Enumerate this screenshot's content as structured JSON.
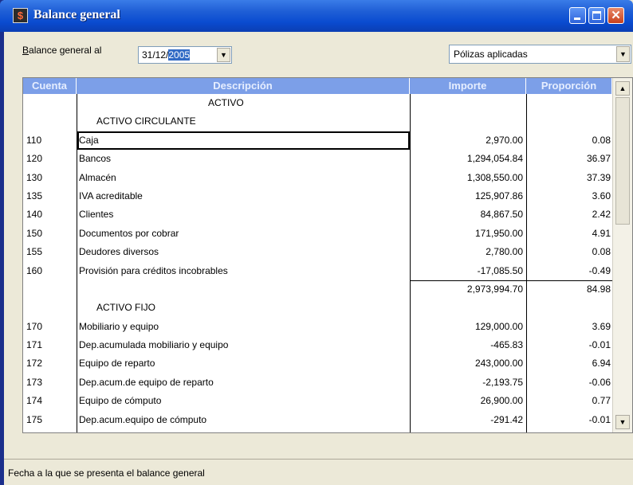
{
  "window": {
    "title": "Balance general",
    "icon": "app-logo-icon"
  },
  "filters": {
    "label_prefix": "B",
    "label_rest": "alance general al",
    "date_plain": "31/12/",
    "date_selected": "2005",
    "polizas_value": "Pólizas aplicadas"
  },
  "grid": {
    "columns": [
      "Cuenta",
      "Descripción",
      "Importe",
      "Proporción"
    ],
    "rows": [
      {
        "type": "heading-center",
        "desc": "ACTIVO"
      },
      {
        "type": "heading-sub",
        "desc": "ACTIVO CIRCULANTE"
      },
      {
        "type": "data",
        "cuenta": "110",
        "desc": "Caja",
        "importe": "2,970.00",
        "prop": "0.08",
        "selected": true
      },
      {
        "type": "data",
        "cuenta": "120",
        "desc": "Bancos",
        "importe": "1,294,054.84",
        "prop": "36.97"
      },
      {
        "type": "data",
        "cuenta": "130",
        "desc": "Almacén",
        "importe": "1,308,550.00",
        "prop": "37.39"
      },
      {
        "type": "data",
        "cuenta": "135",
        "desc": "IVA acreditable",
        "importe": "125,907.86",
        "prop": "3.60"
      },
      {
        "type": "data",
        "cuenta": "140",
        "desc": "Clientes",
        "importe": "84,867.50",
        "prop": "2.42"
      },
      {
        "type": "data",
        "cuenta": "150",
        "desc": "Documentos por cobrar",
        "importe": "171,950.00",
        "prop": "4.91"
      },
      {
        "type": "data",
        "cuenta": "155",
        "desc": "Deudores diversos",
        "importe": "2,780.00",
        "prop": "0.08"
      },
      {
        "type": "data",
        "cuenta": "160",
        "desc": "Provisión para créditos incobrables",
        "importe": "-17,085.50",
        "prop": "-0.49"
      },
      {
        "type": "subtotal",
        "importe": "2,973,994.70",
        "prop": "84.98"
      },
      {
        "type": "heading-sub",
        "desc": "ACTIVO FIJO"
      },
      {
        "type": "data",
        "cuenta": "170",
        "desc": "Mobiliario y equipo",
        "importe": "129,000.00",
        "prop": "3.69"
      },
      {
        "type": "data",
        "cuenta": "171",
        "desc": "Dep.acumulada mobiliario y equipo",
        "importe": "-465.83",
        "prop": "-0.01"
      },
      {
        "type": "data",
        "cuenta": "172",
        "desc": "Equipo de reparto",
        "importe": "243,000.00",
        "prop": "6.94"
      },
      {
        "type": "data",
        "cuenta": "173",
        "desc": "Dep.acum.de equipo de reparto",
        "importe": "-2,193.75",
        "prop": "-0.06"
      },
      {
        "type": "data",
        "cuenta": "174",
        "desc": "Equipo de cómputo",
        "importe": "26,900.00",
        "prop": "0.77"
      },
      {
        "type": "data",
        "cuenta": "175",
        "desc": "Dep.acum.equipo de cómputo",
        "importe": "-291.42",
        "prop": "-0.01"
      }
    ]
  },
  "statusbar": {
    "text": "Fecha a la que se presenta el balance general"
  },
  "colors": {
    "titlebar": "#0a4bd0",
    "header": "#7c9fe8",
    "selection": "#316ac5"
  }
}
